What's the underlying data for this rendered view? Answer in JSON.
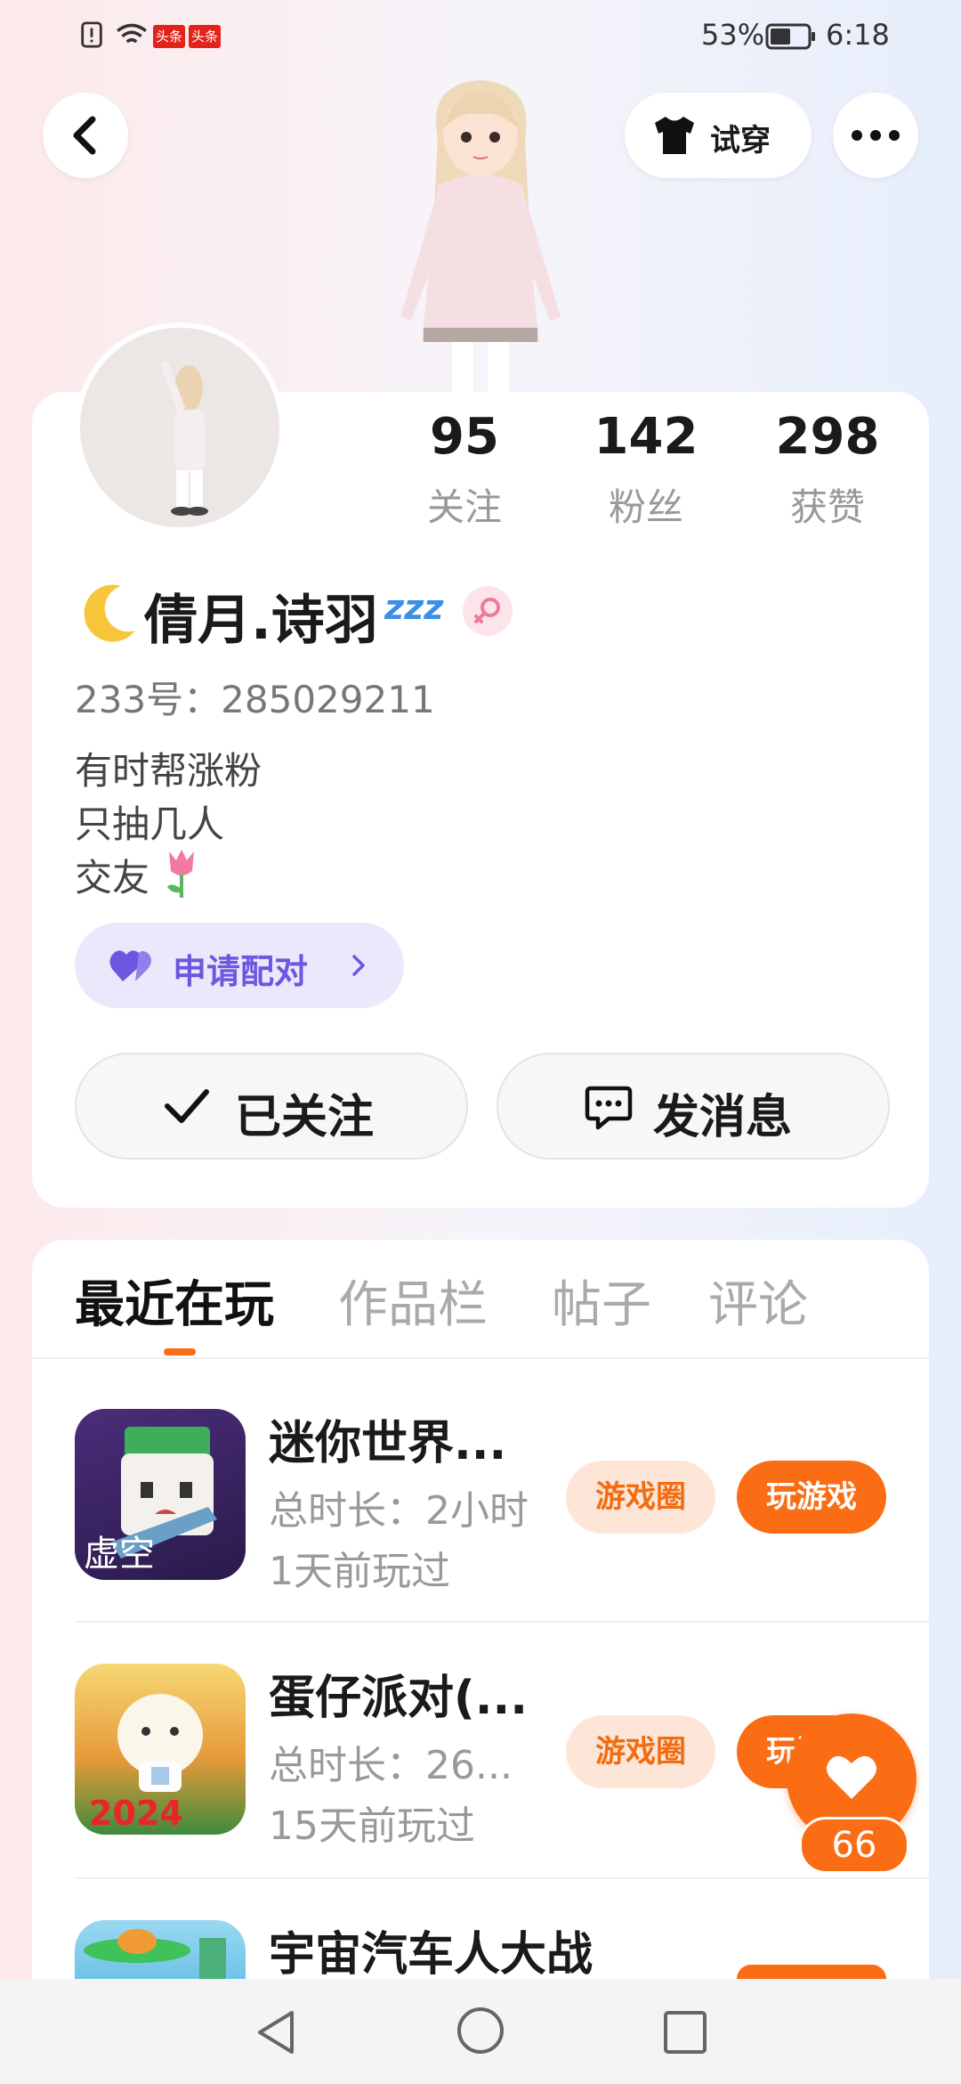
{
  "status_bar": {
    "battery_percent": "53%",
    "time": "6:18",
    "app_badge_1": "头条",
    "app_badge_2": "头条"
  },
  "header": {
    "try_on_label": "试穿"
  },
  "profile": {
    "stats": [
      {
        "value": "95",
        "label": "关注"
      },
      {
        "value": "142",
        "label": "粉丝"
      },
      {
        "value": "298",
        "label": "获赞"
      }
    ],
    "name": "倩月.诗羽",
    "id_label": "233号：285029211",
    "bio_lines": [
      "有时帮涨粉",
      "只抽几人",
      "交友"
    ],
    "pair_label": "申请配对",
    "follow_label": "已关注",
    "message_label": "发消息"
  },
  "tabs": [
    "最近在玩",
    "作品栏",
    "帖子",
    "评论"
  ],
  "games": [
    {
      "title": "迷你世界...",
      "duration": "总时长：2小时",
      "last_played": "1天前玩过",
      "circle_label": "游戏圈",
      "play_label": "玩游戏"
    },
    {
      "title": "蛋仔派对(...",
      "duration": "总时长：26...",
      "last_played": "15天前玩过",
      "circle_label": "游戏圈",
      "play_label": "玩游戏",
      "icon_text": "2024"
    },
    {
      "title": "宇宙汽车人大战"
    }
  ],
  "like_button": {
    "count": "66"
  },
  "colors": {
    "accent_orange": "#fa6d14",
    "pair_purple": "#6b57e0",
    "tag_bg": "#fde6d8"
  }
}
